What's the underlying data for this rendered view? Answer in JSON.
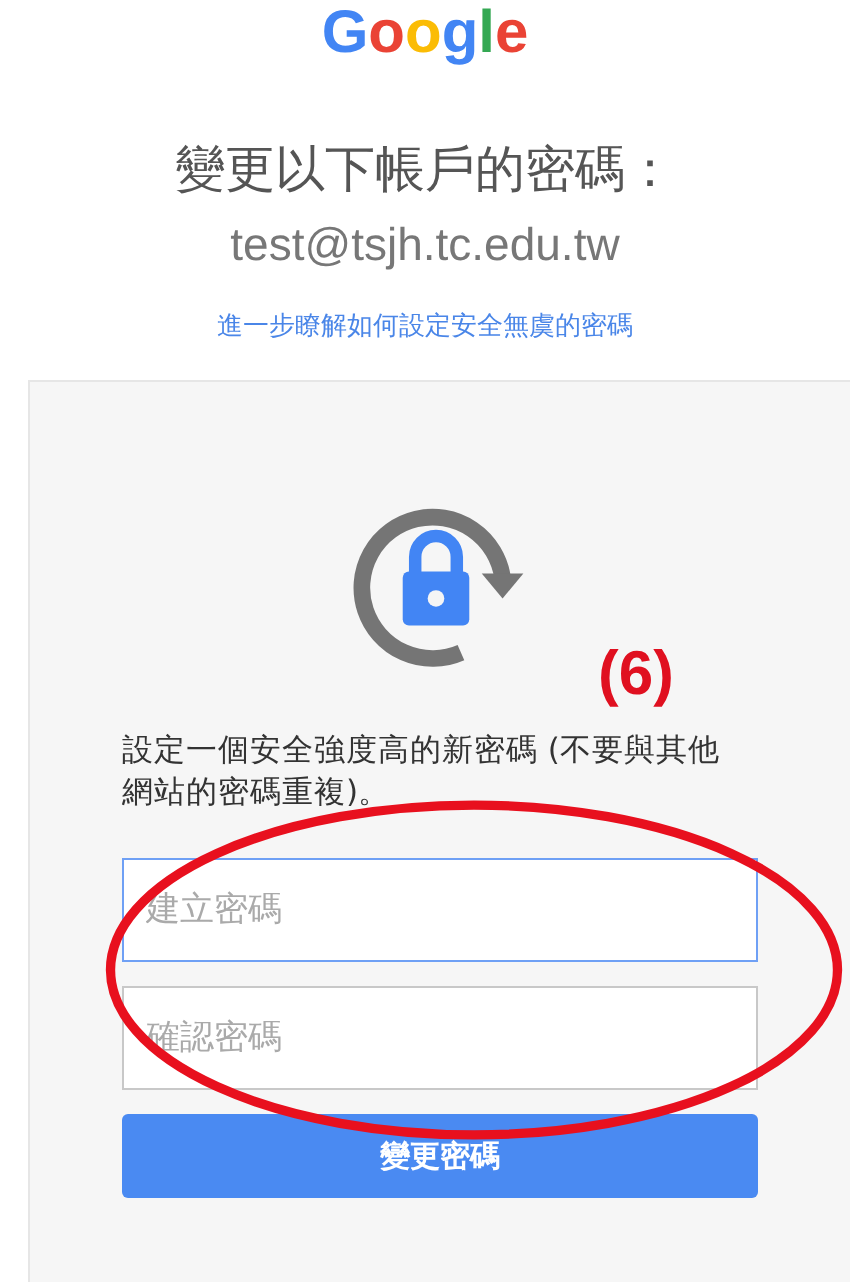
{
  "logo": {
    "letters": [
      {
        "text": "G",
        "color": "#4285f4"
      },
      {
        "text": "o",
        "color": "#ea4335"
      },
      {
        "text": "o",
        "color": "#fbbc05"
      },
      {
        "text": "g",
        "color": "#4285f4"
      },
      {
        "text": "l",
        "color": "#34a853"
      },
      {
        "text": "e",
        "color": "#ea4335"
      }
    ]
  },
  "heading": "變更以下帳戶的密碼：",
  "email": "test@tsjh.tc.edu.tw",
  "help_link": "進一步瞭解如何設定安全無虞的密碼",
  "annotation": "(6)",
  "instructions": "設定一個安全強度高的新密碼 (不要與其他網站的密碼重複)。",
  "fields": [
    {
      "placeholder": "建立密碼",
      "selected": true
    },
    {
      "placeholder": "確認密碼",
      "selected": false
    }
  ],
  "submit_button": "變更密碼"
}
